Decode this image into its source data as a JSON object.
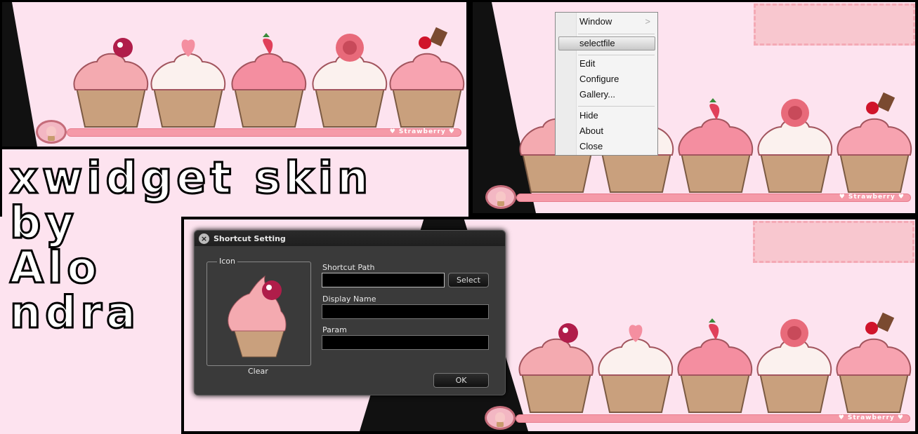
{
  "title_art": {
    "lines": [
      "xwidget skin",
      "by",
      "Alo",
      "ndra"
    ]
  },
  "widget": {
    "bar_label": "♥ Strawberry ♥",
    "cupcakes": [
      "cherry",
      "heart",
      "strawberry",
      "rose",
      "cherry-chocolate"
    ]
  },
  "colors": {
    "background": "#fde3ef",
    "bar": "#f59aa8",
    "dialog": "#3a3a3a"
  },
  "context_menu": {
    "items": [
      {
        "label": "Window",
        "submenu": true
      },
      {
        "label": "selectfile",
        "selected": true
      },
      {
        "label": "Edit"
      },
      {
        "label": "Configure"
      },
      {
        "label": "Gallery..."
      },
      {
        "label": "Hide"
      },
      {
        "label": "About"
      },
      {
        "label": "Close"
      }
    ],
    "submenu_arrow": ">"
  },
  "dialog": {
    "title": "Shortcut Setting",
    "close_icon": "×",
    "icon_group": "Icon",
    "clear": "Clear",
    "shortcut_path_label": "Shortcut Path",
    "shortcut_path_value": "",
    "select": "Select",
    "display_name_label": "Display Name",
    "display_name_value": "",
    "param_label": "Param",
    "param_value": "",
    "ok": "OK"
  }
}
